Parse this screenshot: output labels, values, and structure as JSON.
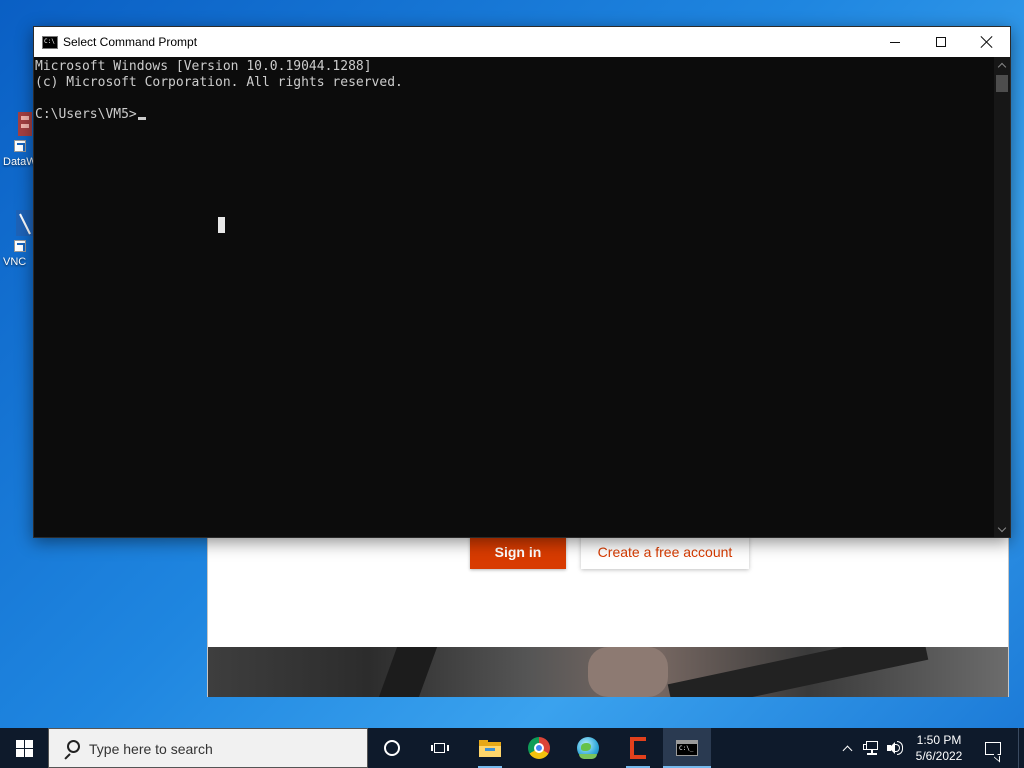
{
  "desktop": {
    "icons": [
      {
        "label": "DataW",
        "icon": "datawarehouse-shortcut-icon"
      },
      {
        "label": "VNC",
        "icon": "vnc-shortcut-icon"
      }
    ]
  },
  "background_window": {
    "signin_label": "Sign in",
    "create_account_label": "Create a free account",
    "accent_color": "#d83b01"
  },
  "cmd_window": {
    "title": "Select Command Prompt",
    "lines": [
      "Microsoft Windows [Version 10.0.19044.1288]",
      "(c) Microsoft Corporation. All rights reserved.",
      "",
      "C:\\Users\\VM5>"
    ],
    "background_color": "#0c0c0c",
    "text_color": "#cccccc"
  },
  "taskbar": {
    "search_placeholder": "Type here to search",
    "pinned": [
      {
        "name": "cortana-icon"
      },
      {
        "name": "task-view-icon"
      },
      {
        "name": "file-explorer-icon",
        "running": true
      },
      {
        "name": "chrome-icon"
      },
      {
        "name": "globe-app-icon"
      },
      {
        "name": "office-icon",
        "running": true
      },
      {
        "name": "command-prompt-icon",
        "active": true
      }
    ],
    "time": "1:50 PM",
    "date": "5/6/2022",
    "background_color": "#0e1a2b"
  }
}
